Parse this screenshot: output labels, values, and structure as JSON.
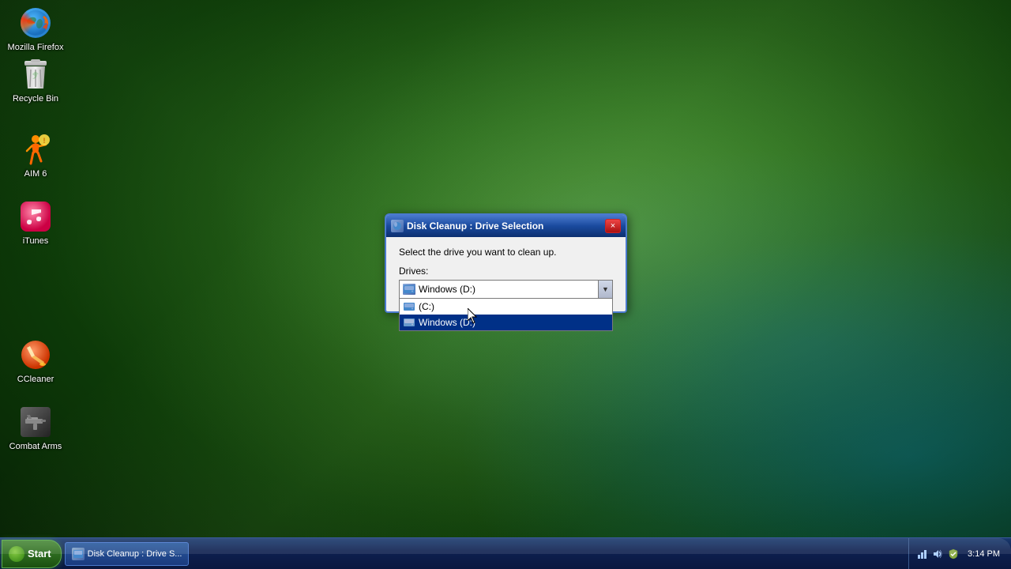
{
  "desktop": {
    "icons": [
      {
        "id": "firefox",
        "label": "Mozilla Firefox",
        "type": "firefox"
      },
      {
        "id": "recycle",
        "label": "Recycle Bin",
        "type": "recycle"
      },
      {
        "id": "aim",
        "label": "AIM 6",
        "type": "aim"
      },
      {
        "id": "itunes",
        "label": "iTunes",
        "type": "itunes"
      },
      {
        "id": "ccleaner",
        "label": "CCleaner",
        "type": "ccleaner"
      },
      {
        "id": "combat",
        "label": "Combat Arms",
        "type": "combat"
      }
    ]
  },
  "dialog": {
    "title": "Disk Cleanup : Drive Selection",
    "description": "Select the drive you want to clean up.",
    "drives_label": "Drives:",
    "selected_drive": "Windows (D:)",
    "drives": [
      {
        "label": "(C:)",
        "type": "hdd"
      },
      {
        "label": "Windows (D:)",
        "type": "hdd"
      }
    ],
    "close_label": "×"
  },
  "taskbar": {
    "start_label": "Start",
    "items": [
      {
        "label": "Disk Cleanup : Drive S..."
      }
    ],
    "clock": "3:14 PM"
  }
}
